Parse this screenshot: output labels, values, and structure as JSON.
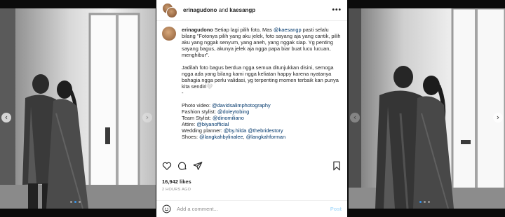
{
  "header": {
    "user1": "erinagudono",
    "connector": "and",
    "user2": "kaesangp",
    "more_icon": "more-horizontal-icon"
  },
  "caption": {
    "username": "erinagudono",
    "paragraph1_pre": " Setiap lagi pilih foto, Mas ",
    "paragraph1_mention": "@kaesangp",
    "paragraph1_post": " pasti selalu bilang \"Fotonya pilih yang aku jelek, foto sayang aja yang cantik, pilih aku yang nggak senyum, yang aneh, yang nggak siap. Yg penting sayang bagus, akunya jelek aja ngga papa biar buat lucu lucuan, menghibur\".",
    "paragraph2": "Jadilah foto bagus berdua ngga semua ditunjukkan disini, semoga ngga ada yang bilang kami ngga keliatan happy karena nyatanya bahagia ngga perlu validasi, yg terpenting momen terbaik kan punya kita sendiri🤍",
    "dash": "-",
    "credits": [
      {
        "label": "Photo video: ",
        "handles": [
          "@davidsalimphotography"
        ]
      },
      {
        "label": "Fashion stylist: ",
        "handles": [
          "@doleytobing"
        ]
      },
      {
        "label": "Team Stylist: ",
        "handles": [
          "@dinomiliano"
        ]
      },
      {
        "label": "Attire: ",
        "handles": [
          "@biyanofficial"
        ]
      },
      {
        "label": "Wedding planner: ",
        "handles": [
          "@by.hilda",
          "@thebridestory"
        ]
      },
      {
        "label": "Shoes: ",
        "handles": [
          "@langkahbylinalee",
          "@langkahforman"
        ]
      }
    ]
  },
  "actions": {
    "like_icon": "heart-icon",
    "comment_icon": "comment-icon",
    "share_icon": "share-icon",
    "save_icon": "bookmark-icon"
  },
  "likes": "16,942 likes",
  "timestamp": "2 HOURS AGO",
  "comment": {
    "placeholder": "Add a comment...",
    "post_label": "Post",
    "emoji_icon": "smiley-icon"
  },
  "carousel": {
    "prev_icon": "chevron-left-icon",
    "next_icon": "chevron-right-icon",
    "left_active_dot": 1,
    "right_active_dot": 0,
    "dot_count": 3
  },
  "colors": {
    "link": "#00376b",
    "post_button": "#b2dffc",
    "active_dot": "#3897f0",
    "secondary_text": "#8e8e8e"
  }
}
